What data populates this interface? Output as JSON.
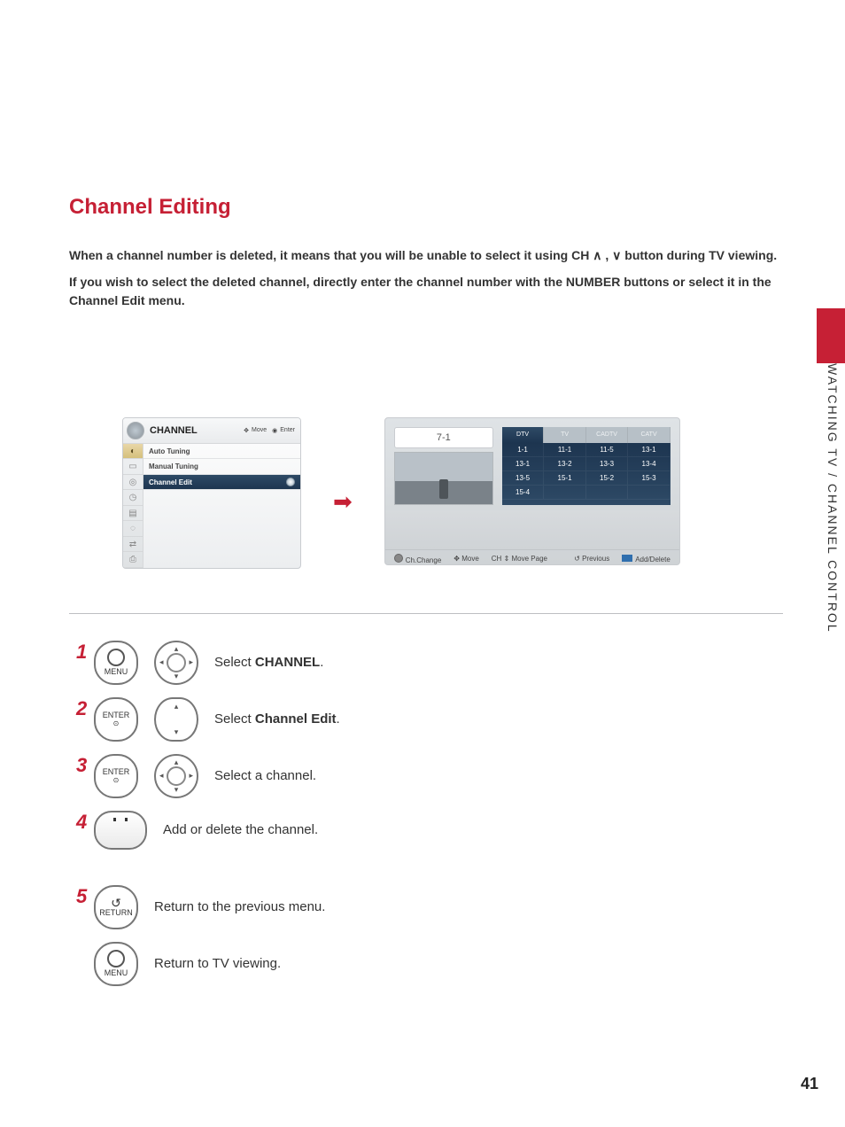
{
  "title": "Channel Editing",
  "intro_p1": "When a channel number is deleted, it means that you will be unable to select it using CH ∧ , ∨ button during TV viewing.",
  "intro_p2": "If you wish to select the deleted channel, directly enter the channel number with the NUMBER buttons or select it in the Channel Edit menu.",
  "section_tab": "WATCHING TV / CHANNEL CONTROL",
  "page_number": "41",
  "osd_menu": {
    "title": "CHANNEL",
    "hint_move": "Move",
    "hint_enter": "Enter",
    "items": [
      "Auto Tuning",
      "Manual Tuning",
      "Channel Edit"
    ],
    "selected_index": 2
  },
  "osd_grid": {
    "indicator": "7-1",
    "tabs": [
      "DTV",
      "TV",
      "CADTV",
      "CATV"
    ],
    "selected_tab": 0,
    "cells": [
      "1-1",
      "11-1",
      "11-5",
      "13-1",
      "13-1",
      "13-2",
      "13-3",
      "13-4",
      "13-5",
      "15-1",
      "15-2",
      "15-3",
      "15-4",
      "",
      "",
      ""
    ],
    "footer": {
      "chchange": "Ch.Change",
      "move": "Move",
      "movepage_prefix": "CH",
      "movepage": "Move Page",
      "previous": "Previous",
      "adddelete": "Add/Delete"
    }
  },
  "steps": {
    "s1": {
      "num": "1",
      "btn": "MENU",
      "text_pre": "Select ",
      "text_bold": "CHANNEL",
      "text_post": "."
    },
    "s2": {
      "num": "2",
      "btn": "ENTER",
      "text_pre": "Select ",
      "text_bold": "Channel Edit",
      "text_post": "."
    },
    "s3": {
      "num": "3",
      "btn": "ENTER",
      "text": "Select a channel."
    },
    "s4": {
      "num": "4",
      "text": "Add or delete the channel."
    },
    "s5": {
      "num": "5",
      "btn": "RETURN",
      "text": "Return to the previous menu."
    },
    "s6": {
      "btn": "MENU",
      "text": "Return to TV viewing."
    }
  }
}
